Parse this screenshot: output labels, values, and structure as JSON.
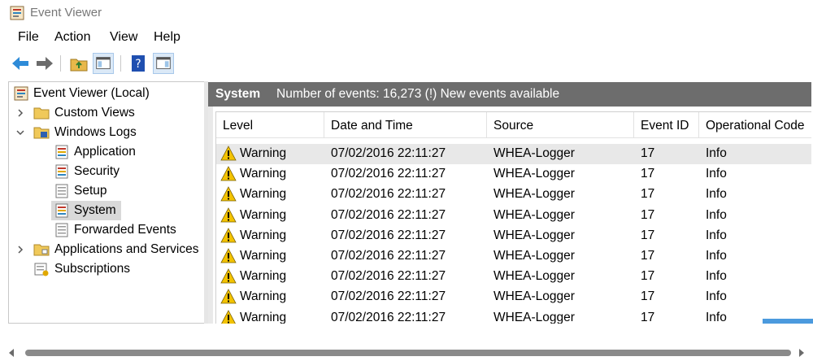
{
  "window": {
    "title": "Event Viewer",
    "icon": "event-viewer-icon"
  },
  "menu": [
    "File",
    "Action",
    "View",
    "Help"
  ],
  "toolbar": {
    "buttons": [
      "back-arrow-icon",
      "forward-arrow-icon",
      "folder-up-icon",
      "show-hide-console-tree-icon",
      "help-icon",
      "show-hide-action-pane-icon"
    ]
  },
  "tree": {
    "root": "Event Viewer (Local)",
    "custom_views": "Custom Views",
    "windows_logs": "Windows Logs",
    "application": "Application",
    "security": "Security",
    "setup": "Setup",
    "system": "System",
    "forwarded_events": "Forwarded Events",
    "apps_services": "Applications and Services",
    "subscriptions": "Subscriptions"
  },
  "panel": {
    "title": "System",
    "info": "Number of events: 16,273 (!) New events available"
  },
  "table": {
    "columns": [
      "Level",
      "Date and Time",
      "Source",
      "Event ID",
      "Operational Code"
    ],
    "rows": [
      [
        "Warning",
        "07/02/2016 22:11:27",
        "WHEA-Logger",
        "17",
        "Info"
      ],
      [
        "Warning",
        "07/02/2016 22:11:27",
        "WHEA-Logger",
        "17",
        "Info"
      ],
      [
        "Warning",
        "07/02/2016 22:11:27",
        "WHEA-Logger",
        "17",
        "Info"
      ],
      [
        "Warning",
        "07/02/2016 22:11:27",
        "WHEA-Logger",
        "17",
        "Info"
      ],
      [
        "Warning",
        "07/02/2016 22:11:27",
        "WHEA-Logger",
        "17",
        "Info"
      ],
      [
        "Warning",
        "07/02/2016 22:11:27",
        "WHEA-Logger",
        "17",
        "Info"
      ],
      [
        "Warning",
        "07/02/2016 22:11:27",
        "WHEA-Logger",
        "17",
        "Info"
      ],
      [
        "Warning",
        "07/02/2016 22:11:27",
        "WHEA-Logger",
        "17",
        "Info"
      ],
      [
        "Warning",
        "07/02/2016 22:11:27",
        "WHEA-Logger",
        "17",
        "Info"
      ]
    ]
  },
  "colors": {
    "header_bg": "#6d6d6d",
    "selection": "#d9d9d9",
    "warning": "#f2c200",
    "accent": "#2b88d8"
  }
}
